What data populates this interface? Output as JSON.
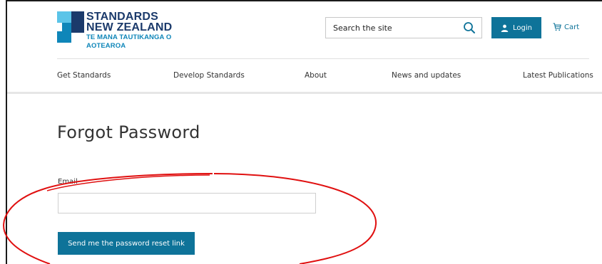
{
  "brand": {
    "line1": "STANDARDS",
    "line2": "NEW ZEALAND",
    "line3": "TE MANA TAUTIKANGA O AOTEAROA",
    "colors": {
      "navy": "#1b3a6b",
      "teal": "#0f86b9",
      "light": "#5bc4e8"
    }
  },
  "header": {
    "search_placeholder": "Search the site",
    "login_label": "Login",
    "cart_label": "Cart",
    "accent_color": "#0e7399"
  },
  "nav": {
    "items": [
      {
        "label": "Get Standards"
      },
      {
        "label": "Develop Standards"
      },
      {
        "label": "About"
      },
      {
        "label": "News and updates"
      },
      {
        "label": "Latest Publications"
      }
    ]
  },
  "page": {
    "title": "Forgot Password",
    "email_label": "Email",
    "email_value": "",
    "submit_label": "Send me the password reset link"
  },
  "annotation": {
    "shape": "ellipse",
    "color": "#e01010"
  }
}
